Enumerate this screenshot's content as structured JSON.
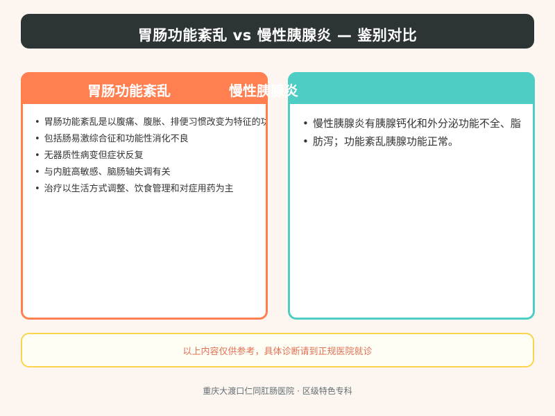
{
  "header": {
    "title": "胃肠功能紊乱 vs 慢性胰腺炎 — 鉴别对比"
  },
  "left_panel": {
    "title": "胃肠功能紊乱",
    "items": [
      "胃肠功能紊乱是以腹痛、腹胀、排便习惯改变为特征的功能",
      "包括肠易激综合征和功能性消化不良",
      "无器质性病变但症状反复",
      "与内脏高敏感、脑肠轴失调有关",
      "治疗以生活方式调整、饮食管理和对症用药为主"
    ]
  },
  "right_panel": {
    "title": "慢性胰腺炎",
    "items": [
      "慢性胰腺炎有胰腺钙化和外分泌功能不全、脂",
      "肪泻；功能紊乱胰腺功能正常。"
    ]
  },
  "notice": {
    "text": "以上内容仅供参考，具体诊断请到正规医院就诊"
  },
  "footer": {
    "text": "重庆大渡口仁同肛肠医院 · 区级特色专科"
  },
  "colors": {
    "title_bar": "#2d3436",
    "left_accent": "#ff7f50",
    "right_accent": "#4ecdc4",
    "notice_border": "#fcd34d",
    "notice_text": "#e17055",
    "background": "#fdf6f0"
  }
}
